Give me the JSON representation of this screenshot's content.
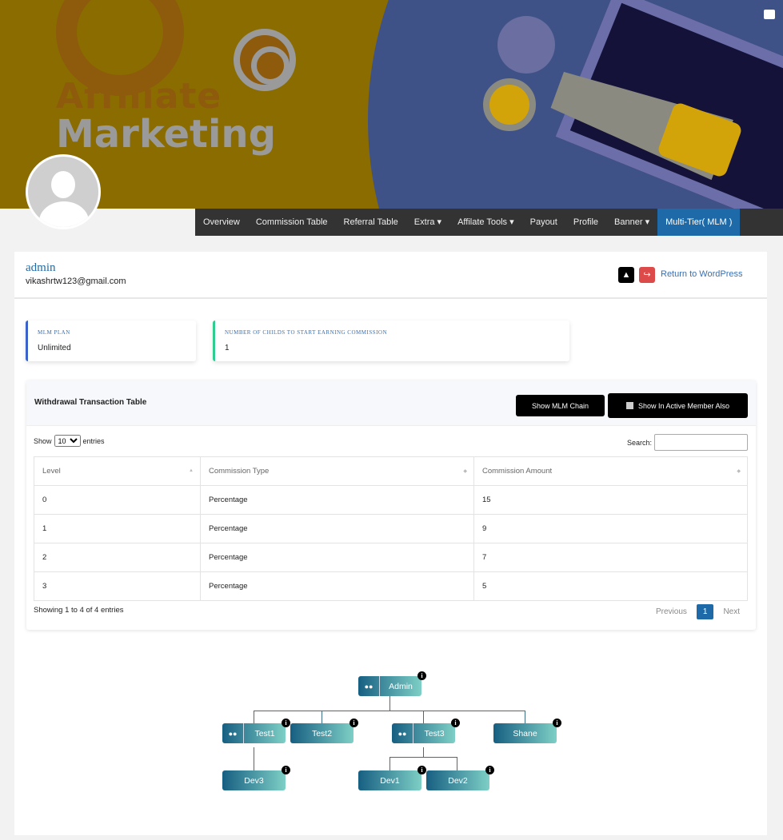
{
  "banner": {
    "line1": "Affiliate",
    "line2": "Marketing",
    "camera_icon": "camera-icon"
  },
  "nav": [
    {
      "label": "Overview"
    },
    {
      "label": "Commission Table"
    },
    {
      "label": "Referral Table"
    },
    {
      "label": "Extra ▾"
    },
    {
      "label": "Affilate Tools ▾"
    },
    {
      "label": "Payout"
    },
    {
      "label": "Profile"
    },
    {
      "label": "Banner ▾"
    },
    {
      "label": "Multi-Tier( MLM )",
      "active": true
    }
  ],
  "user": {
    "name": "admin",
    "email": "vikashrtw123@gmail.com"
  },
  "header": {
    "return_label": "Return to WordPress"
  },
  "stats": [
    {
      "label": "MLM Plan",
      "value": "Unlimited",
      "color": "#3a62c9"
    },
    {
      "label": "Number of childs to start earning commission",
      "value": "1",
      "color": "#2ecc8f"
    }
  ],
  "panel": {
    "title": "Withdrawal Transaction Table",
    "show_chain": "Show MLM Chain",
    "inactive": "Show In Active Member Also",
    "show": "Show",
    "entries": "entries",
    "page_size": "10",
    "search_label": "Search:",
    "search_value": "",
    "columns": [
      "Level",
      "Commission Type",
      "Commission Amount"
    ],
    "rows": [
      [
        "0",
        "Percentage",
        "15"
      ],
      [
        "1",
        "Percentage",
        "9"
      ],
      [
        "2",
        "Percentage",
        "7"
      ],
      [
        "3",
        "Percentage",
        "5"
      ]
    ],
    "info": "Showing 1 to 4 of 4 entries",
    "prev": "Previous",
    "page": "1",
    "next": "Next"
  },
  "tree": {
    "admin": "Admin",
    "test1": "Test1",
    "test2": "Test2",
    "test3": "Test3",
    "shane": "Shane",
    "dev3": "Dev3",
    "dev1": "Dev1",
    "dev2": "Dev2",
    "info": "i"
  },
  "colors": {
    "accent": "#1e6aa8",
    "nav_bg": "#333333",
    "node_start": "#175f82",
    "node_end": "#7ecfc6",
    "danger": "#dc4a4a"
  }
}
